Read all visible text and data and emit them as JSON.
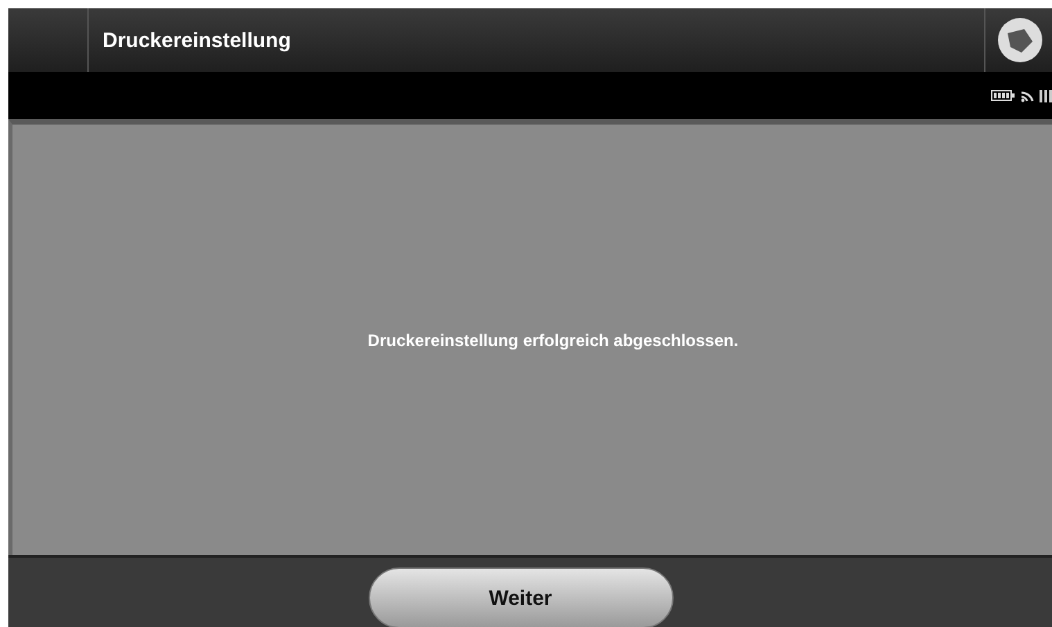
{
  "header": {
    "title": "Druckereinstellung"
  },
  "message": "Druckereinstellung erfolgreich abgeschlossen.",
  "buttons": [
    "Weiter"
  ]
}
